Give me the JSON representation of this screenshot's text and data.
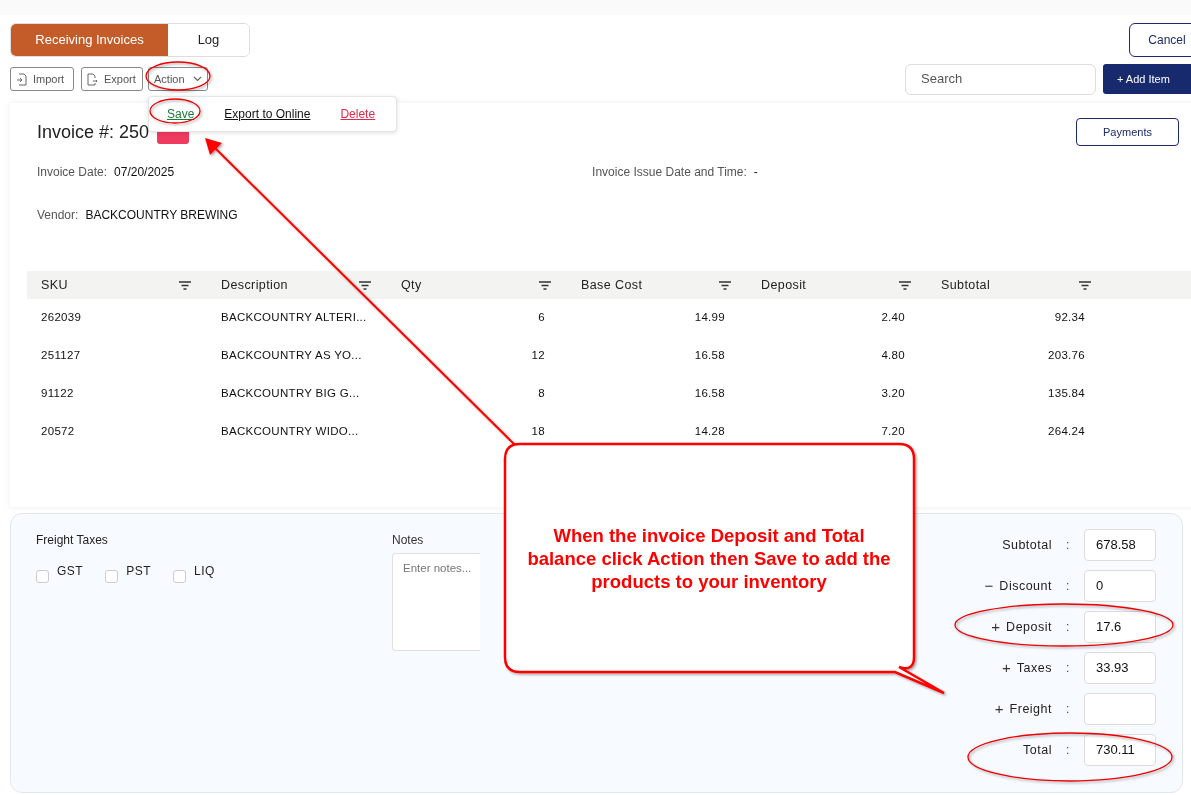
{
  "tabs": [
    {
      "label": "Receiving Invoices",
      "selected": true
    },
    {
      "label": "Log",
      "selected": false
    }
  ],
  "cancel_button": "Cancel",
  "toolbar": {
    "import": "Import",
    "export": "Export",
    "action": {
      "label": "Action",
      "expanded": true
    }
  },
  "search": {
    "placeholder": "Search"
  },
  "add_button": "+ Add Item",
  "action_menu": [
    {
      "label": "Save",
      "kind": "save"
    },
    {
      "label": "Export to Online",
      "kind": "plain"
    },
    {
      "label": "Delete",
      "kind": "danger"
    }
  ],
  "invoice": {
    "title": "Invoice #: 250",
    "date_label": "Invoice Date:",
    "date": "07/20/2025",
    "issue_label": "Invoice Issue Date and Time:",
    "issue_value": "-",
    "vendor_label": "Vendor:",
    "vendor": "BACKCOUNTRY BREWING"
  },
  "payments_button": "Payments",
  "table": {
    "columns": [
      {
        "label": "SKU"
      },
      {
        "label": "Description"
      },
      {
        "label": "Qty"
      },
      {
        "label": "Base Cost"
      },
      {
        "label": "Deposit"
      },
      {
        "label": "Subtotal"
      }
    ],
    "rows": [
      [
        "262039",
        "BACKCOUNTRY ALTERI...",
        "6",
        "14.99",
        "2.40",
        "92.34"
      ],
      [
        "251127",
        "BACKCOUNTRY AS YO...",
        "12",
        "16.58",
        "4.80",
        "203.76"
      ],
      [
        "91122",
        "BACKCOUNTRY BIG G...",
        "8",
        "16.58",
        "3.20",
        "135.84"
      ],
      [
        "20572",
        "BACKCOUNTRY WIDO...",
        "18",
        "14.28",
        "7.20",
        "264.24"
      ]
    ]
  },
  "freight_taxes": {
    "title": "Freight Taxes",
    "options": [
      {
        "label": "GST",
        "checked": false
      },
      {
        "label": "PST",
        "checked": false
      },
      {
        "label": "LIQ",
        "checked": false
      }
    ]
  },
  "notes": {
    "label": "Notes",
    "placeholder": "Enter notes..."
  },
  "totals": [
    {
      "label": "Subtotal",
      "colon": ":",
      "value": "678.58"
    },
    {
      "sign": "−",
      "label": "Discount",
      "colon": ":",
      "value": "0"
    },
    {
      "sign": "+",
      "label": "Deposit",
      "colon": ":",
      "value": "17.6"
    },
    {
      "sign": "+",
      "label": "Taxes",
      "colon": ":",
      "value": "33.93"
    },
    {
      "sign": "+",
      "label": "Freight",
      "colon": ":"
    },
    {
      "label": "Total",
      "colon": ":",
      "value": "730.11"
    }
  ],
  "callout": {
    "text": "When the invoice Deposit and Total balance click Action then Save to add the products to your inventory"
  }
}
